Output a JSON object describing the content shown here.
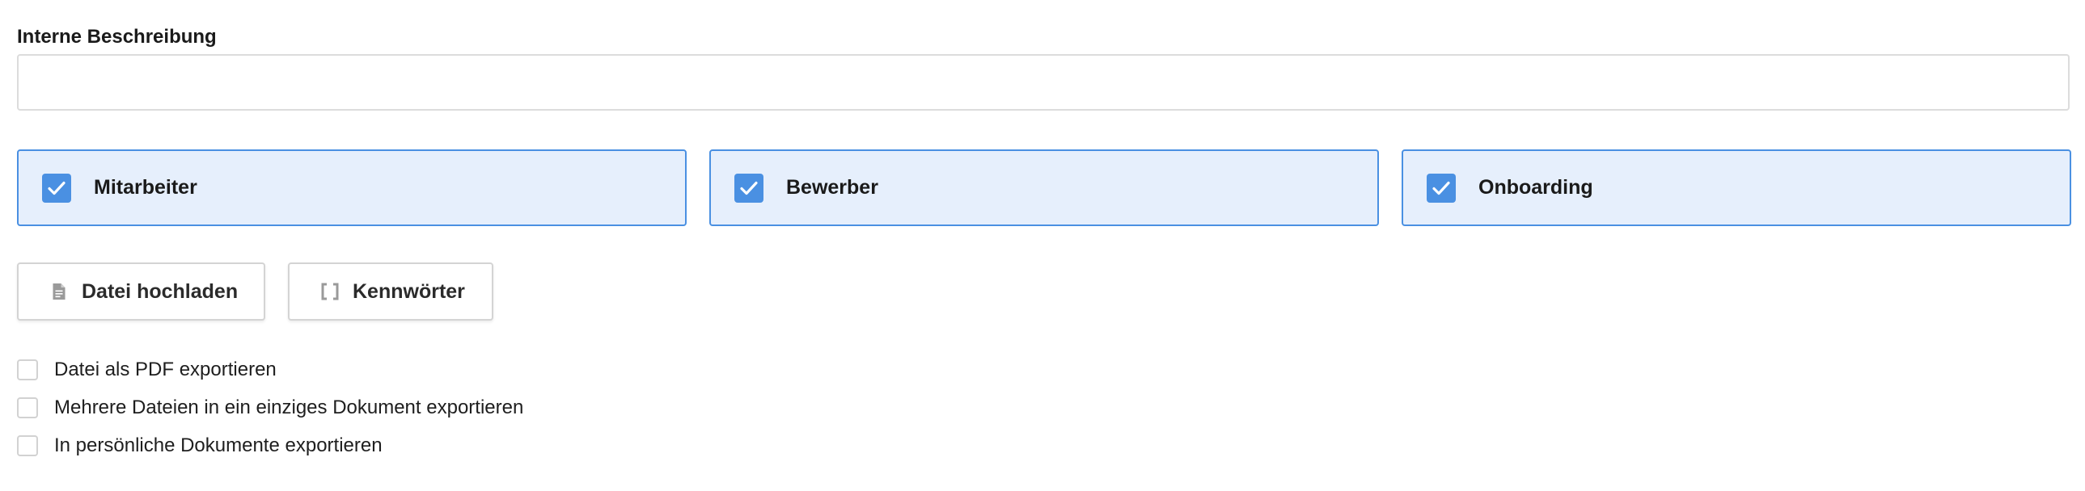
{
  "form": {
    "description_label": "Interne Beschreibung",
    "description_value": "",
    "description_placeholder": ""
  },
  "tiles": [
    {
      "label": "Mitarbeiter",
      "checked": true
    },
    {
      "label": "Bewerber",
      "checked": true
    },
    {
      "label": "Onboarding",
      "checked": true
    }
  ],
  "buttons": {
    "upload_label": "Datei hochladen",
    "upload_icon": "document-icon",
    "keywords_label": "Kennwörter",
    "keywords_icon": "brackets-icon"
  },
  "options": [
    {
      "label": "Datei als PDF exportieren",
      "checked": false
    },
    {
      "label": "Mehrere Dateien in ein einziges Dokument exportieren",
      "checked": false
    },
    {
      "label": "In persönliche Dokumente exportieren",
      "checked": false
    }
  ],
  "colors": {
    "accent": "#4a90e2",
    "tile_background": "#e6effc",
    "border": "#dcdcdc",
    "text": "#1a1a1a"
  }
}
